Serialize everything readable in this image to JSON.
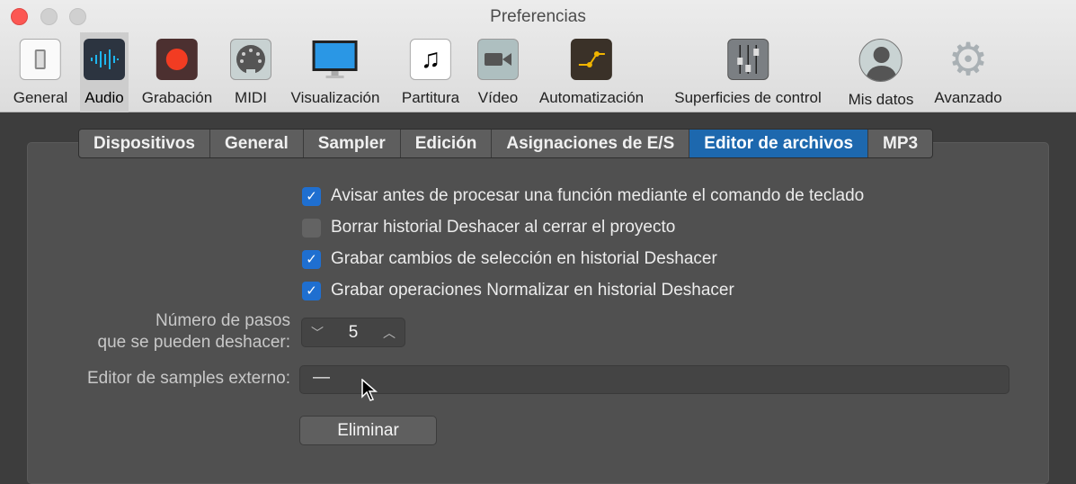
{
  "window": {
    "title": "Preferencias"
  },
  "toolbar": [
    {
      "label": "General",
      "icon": "switch-icon"
    },
    {
      "label": "Audio",
      "icon": "waveform-icon",
      "selected": true
    },
    {
      "label": "Grabación",
      "icon": "record-icon"
    },
    {
      "label": "MIDI",
      "icon": "midi-connector-icon"
    },
    {
      "label": "Visualización",
      "icon": "monitor-icon"
    },
    {
      "label": "Partitura",
      "icon": "music-note-icon"
    },
    {
      "label": "Vídeo",
      "icon": "video-camera-icon"
    },
    {
      "label": "Automatización",
      "icon": "automation-icon"
    },
    {
      "label": "Superficies de control",
      "icon": "faders-icon"
    },
    {
      "label": "Mis datos",
      "icon": "user-icon"
    },
    {
      "label": "Avanzado",
      "icon": "gear-icon"
    }
  ],
  "tabs": [
    {
      "label": "Dispositivos"
    },
    {
      "label": "General"
    },
    {
      "label": "Sampler"
    },
    {
      "label": "Edición"
    },
    {
      "label": "Asignaciones de E/S"
    },
    {
      "label": "Editor de archivos",
      "active": true
    },
    {
      "label": "MP3"
    }
  ],
  "checkboxes": [
    {
      "label": "Avisar antes de procesar una función mediante el comando de teclado",
      "checked": true
    },
    {
      "label": "Borrar historial Deshacer al cerrar el proyecto",
      "checked": false
    },
    {
      "label": "Grabar cambios de selección en historial Deshacer",
      "checked": true
    },
    {
      "label": "Grabar operaciones Normalizar en historial Deshacer",
      "checked": true
    }
  ],
  "undo_steps": {
    "label_line1": "Número de pasos",
    "label_line2": "que se pueden deshacer:",
    "value": "5"
  },
  "external_editor": {
    "label": "Editor de samples externo:",
    "value": "—"
  },
  "remove_button": "Eliminar",
  "colors": {
    "accent": "#1d68ae",
    "close": "#fc5753"
  }
}
